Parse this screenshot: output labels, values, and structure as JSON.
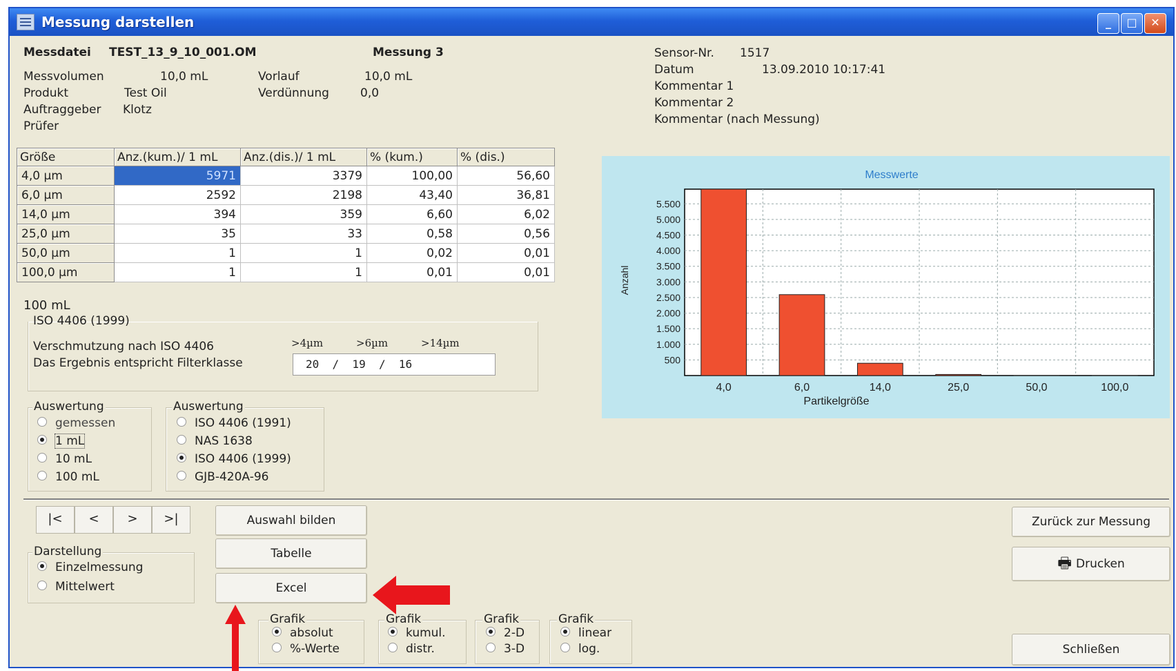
{
  "window": {
    "title": "Messung darstellen"
  },
  "header": {
    "messdatei_label": "Messdatei",
    "messdatei_value": "TEST_13_9_10_001.OM",
    "messung_label": "Messung 3",
    "messvolumen_label": "Messvolumen",
    "messvolumen_value": "10,0 mL",
    "vorlauf_label": "Vorlauf",
    "vorlauf_value": "10,0 mL",
    "produkt_label": "Produkt",
    "produkt_value": "Test Oil",
    "verduennung_label": "Verdünnung",
    "verduennung_value": "0,0",
    "auftraggeber_label": "Auftraggeber",
    "auftraggeber_value": "Klotz",
    "pruefer_label": "Prüfer",
    "sensor_label": "Sensor-Nr.",
    "sensor_value": "1517",
    "datum_label": "Datum",
    "datum_value": "13.09.2010  10:17:41",
    "kommentar1": "Kommentar 1",
    "kommentar2": "Kommentar 2",
    "kommentar3": "Kommentar (nach Messung)"
  },
  "table": {
    "headers": [
      "Größe",
      "Anz.(kum.)/ 1 mL",
      "Anz.(dis.)/ 1 mL",
      "% (kum.)",
      "% (dis.)"
    ],
    "rows": [
      [
        "4,0 µm",
        "5971",
        "3379",
        "100,00",
        "56,60"
      ],
      [
        "6,0 µm",
        "2592",
        "2198",
        "43,40",
        "36,81"
      ],
      [
        "14,0 µm",
        "394",
        "359",
        "6,60",
        "6,02"
      ],
      [
        "25,0 µm",
        "35",
        "33",
        "0,58",
        "0,56"
      ],
      [
        "50,0 µm",
        "1",
        "1",
        "0,02",
        "0,01"
      ],
      [
        "100,0 µm",
        "1",
        "1",
        "0,01",
        "0,01"
      ]
    ]
  },
  "iso_section": {
    "volume_label": "100 mL",
    "group_title": "ISO 4406 (1999)",
    "line1": "Verschmutzung nach ISO 4406",
    "line2": "Das Ergebnis entspricht Filterklasse",
    "col1": ">4µm",
    "col2": ">6µm",
    "col3": ">14µm",
    "class_value": "20  /  19  /  16"
  },
  "auswertung1": {
    "title": "Auswertung",
    "options": [
      "gemessen",
      "1 mL",
      "10 mL",
      "100 mL"
    ],
    "selected": 1
  },
  "auswertung2": {
    "title": "Auswertung",
    "options": [
      "ISO 4406 (1991)",
      "NAS 1638",
      "ISO 4406 (1999)",
      "GJB-420A-96"
    ],
    "selected": 2
  },
  "nav": {
    "first": "|<",
    "prev": "<",
    "next": ">",
    "last": ">|"
  },
  "darstellung": {
    "title": "Darstellung",
    "options": [
      "Einzelmessung",
      "Mittelwert"
    ],
    "selected": 0
  },
  "buttons": {
    "auswahl": "Auswahl bilden",
    "tabelle": "Tabelle",
    "excel": "Excel",
    "zurueck": "Zurück zur Messung",
    "drucken": "Drucken",
    "schliessen": "Schließen"
  },
  "grafik_groups": [
    {
      "title": "Grafik",
      "options": [
        "absolut",
        "%-Werte"
      ],
      "selected": 0
    },
    {
      "title": "Grafik",
      "options": [
        "kumul.",
        "distr."
      ],
      "selected": 0
    },
    {
      "title": "Grafik",
      "options": [
        "2-D",
        "3-D"
      ],
      "selected": 0
    },
    {
      "title": "Grafik",
      "options": [
        "linear",
        "log."
      ],
      "selected": 0
    }
  ],
  "colors": {
    "bar": "#ef5030",
    "annotation_arrow": "#e8161c",
    "chart_bg": "#bfe6ef",
    "title_blue": "#1a52c4"
  },
  "chart_data": {
    "type": "bar",
    "title": "Messwerte",
    "xlabel": "Partikelgröße",
    "ylabel": "Anzahl",
    "categories": [
      "4,0",
      "6,0",
      "14,0",
      "25,0",
      "50,0",
      "100,0"
    ],
    "values": [
      5971,
      2592,
      394,
      35,
      1,
      1
    ],
    "yticks": [
      "500",
      "1.000",
      "1.500",
      "2.000",
      "2.500",
      "3.000",
      "3.500",
      "4.000",
      "4.500",
      "5.000",
      "5.500"
    ],
    "ytick_values": [
      500,
      1000,
      1500,
      2000,
      2500,
      3000,
      3500,
      4000,
      4500,
      5000,
      5500
    ],
    "ylim": [
      0,
      5971
    ],
    "grid": true
  }
}
